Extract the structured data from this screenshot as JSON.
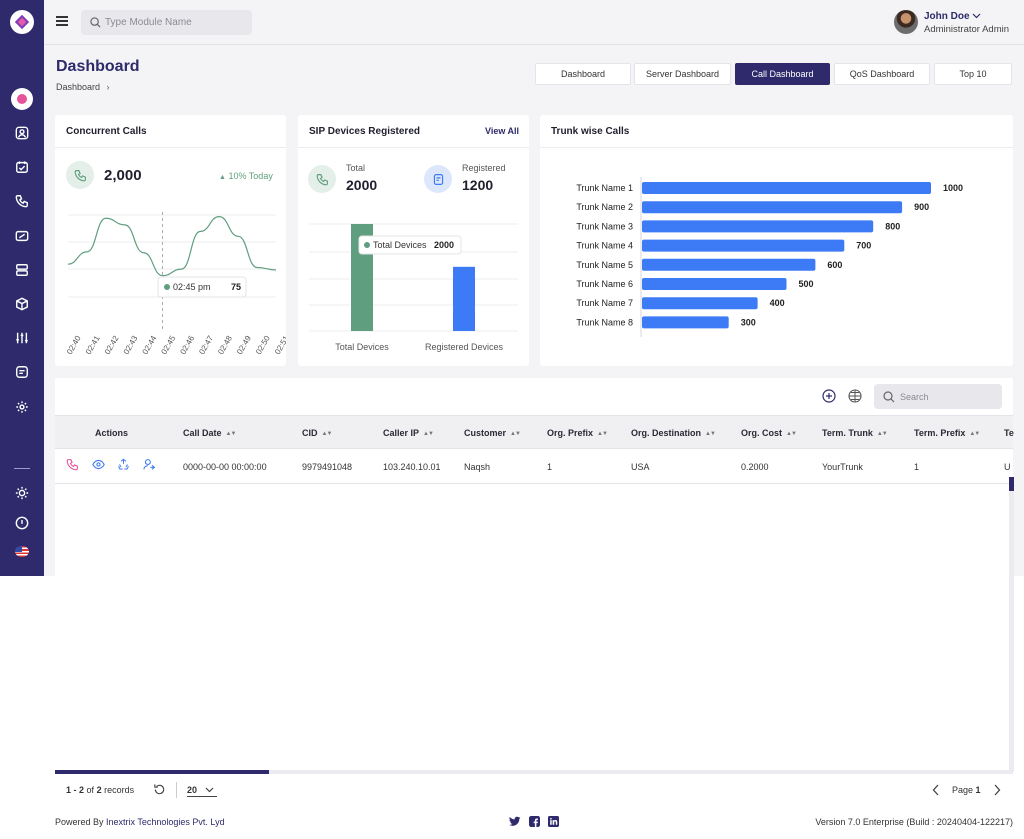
{
  "search": {
    "placeholder": "Type Module Name"
  },
  "user": {
    "name": "John Doe",
    "role": "Administrator Admin"
  },
  "page": {
    "title": "Dashboard",
    "breadcrumb": "Dashboard"
  },
  "tabs": [
    {
      "label": "Dashboard"
    },
    {
      "label": "Server Dashboard"
    },
    {
      "label": "Call Dashboard",
      "active": true
    },
    {
      "label": "QoS Dashboard"
    },
    {
      "label": "Top 10"
    }
  ],
  "concurrent": {
    "title": "Concurrent Calls",
    "value": "2,000",
    "trend": "10% Today",
    "tooltip_time": "02:45 pm",
    "tooltip_value": "75",
    "chart_data": {
      "type": "line",
      "x": [
        "02:40",
        "02:41",
        "02:42",
        "02:43",
        "02:44",
        "02:45",
        "02:46",
        "02:47",
        "02:48",
        "02:49",
        "02:50",
        "02:51"
      ],
      "series": [
        {
          "values": [
            40,
            55,
            96,
            88,
            54,
            26,
            34,
            80,
            98,
            74,
            36,
            33
          ]
        }
      ],
      "ylim": [
        0,
        100
      ],
      "grid": true
    }
  },
  "sip": {
    "title": "SIP Devices Registered",
    "view_all": "View All",
    "total_label": "Total",
    "total_value": "2000",
    "registered_label": "Registered",
    "registered_value": "1200",
    "tooltip_label": "Total Devices",
    "tooltip_value": "2000",
    "chart_data": {
      "type": "bar",
      "categories": [
        "Total Devices",
        "Registered Devices"
      ],
      "values": [
        2000,
        1200
      ],
      "ylim": [
        0,
        2000
      ],
      "colors": [
        "#5f9e7e",
        "#3d7af5"
      ]
    }
  },
  "trunk": {
    "title": "Trunk wise Calls",
    "chart_data": {
      "type": "bar",
      "orientation": "horizontal",
      "categories": [
        "Trunk Name 1",
        "Trunk Name 2",
        "Trunk Name 3",
        "Trunk Name 4",
        "Trunk Name 5",
        "Trunk Name 6",
        "Trunk Name 7",
        "Trunk Name 8"
      ],
      "values": [
        1000,
        900,
        800,
        700,
        600,
        500,
        400,
        300
      ],
      "color": "#3d7af5"
    }
  },
  "table": {
    "search_placeholder": "Search",
    "columns": [
      "Actions",
      "Call Date",
      "CID",
      "Caller IP",
      "Customer",
      "Org. Prefix",
      "Org. Destination",
      "Org. Cost",
      "Term. Trunk",
      "Term. Prefix",
      "Te"
    ],
    "rows": [
      {
        "call_date": "0000-00-00 00:00:00",
        "cid": "9979491048",
        "caller_ip": "103.240.10.01",
        "customer": "Naqsh",
        "org_prefix": "1",
        "org_destination": "USA",
        "org_cost": "0.2000",
        "term_trunk": "YourTrunk",
        "term_prefix": "1",
        "te": "U"
      }
    ]
  },
  "pagination": {
    "range": "1 - 2",
    "of": "of",
    "total": "2",
    "records": "records",
    "page_size": "20",
    "page_label": "Page",
    "page": "1"
  },
  "footer": {
    "powered": "Powered By",
    "company": "Inextrix Technologies Pvt. Lyd",
    "version": "Version 7.0 Enterprise (Build : 20240404-122217)"
  },
  "colors": {
    "brand": "#2e2a6b",
    "accent_pink": "#e6539a",
    "bar_blue": "#3d7af5",
    "green": "#5f9e7e"
  }
}
